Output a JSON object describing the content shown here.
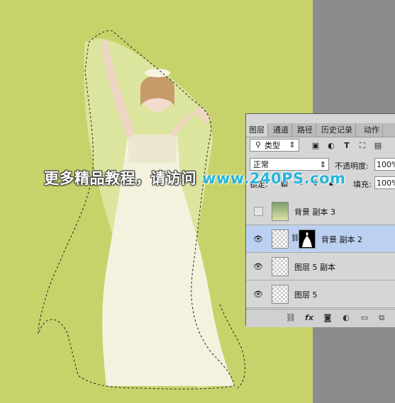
{
  "canvas": {
    "background": "#c7d26b"
  },
  "watermark": {
    "chinese_text": "更多精品教程，请访问",
    "url_text": "www.240PS.com"
  },
  "layers_panel": {
    "tabs": [
      {
        "label": "图层"
      },
      {
        "label": "通道"
      },
      {
        "label": "路径"
      },
      {
        "label": "历史记录"
      },
      {
        "label": "动作"
      }
    ],
    "filter": {
      "label": "类型",
      "search_icon": "search-icon",
      "dropdown_icon": "chevron-down-icon"
    },
    "filter_icons": [
      "image-filter-icon",
      "adjustment-filter-icon",
      "text-filter-icon",
      "shape-filter-icon",
      "smart-object-filter-icon"
    ],
    "blend_mode": {
      "value": "正常"
    },
    "opacity": {
      "label": "不透明度:",
      "value": "100%"
    },
    "lock": {
      "label": "锁定:"
    },
    "fill": {
      "label": "填充:",
      "value": "100%"
    },
    "layers": [
      {
        "name": "背景 副本 3",
        "visible": false,
        "selected": false,
        "has_mask": false
      },
      {
        "name": "背景 副本 2",
        "visible": true,
        "selected": true,
        "has_mask": true
      },
      {
        "name": "图层 5 副本",
        "visible": true,
        "selected": false,
        "has_mask": false
      },
      {
        "name": "图层 5",
        "visible": true,
        "selected": false,
        "has_mask": false
      }
    ],
    "bottom_icons": [
      "link-icon",
      "fx-icon",
      "add-mask-icon",
      "adjustment-layer-icon",
      "new-group-icon",
      "new-layer-icon"
    ],
    "fx_label": "fx",
    "selected_color": "#bcd1f1"
  }
}
